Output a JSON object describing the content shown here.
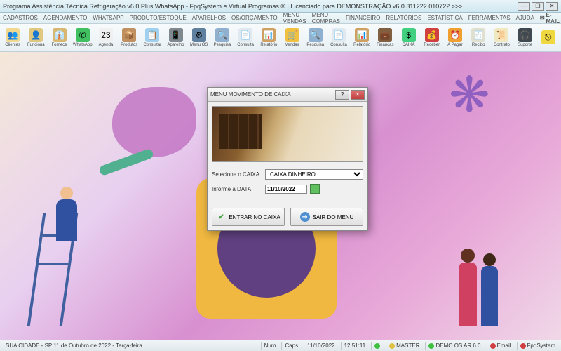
{
  "window": {
    "title": "Programa Assistência Técnica Refrigeração v6.0 Plus WhatsApp - FpqSystem e Virtual Programas ® | Licenciado para DEMONSTRAÇÃO v6.0 311222 010722 >>>"
  },
  "menubar": {
    "items": [
      "CADASTROS",
      "AGENDAMENTO",
      "WHATSAPP",
      "PRODUTO/ESTOQUE",
      "APARELHOS",
      "OS/ORÇAMENTO",
      "MENU VENDAS",
      "MENU COMPRAS",
      "FINANCEIRO",
      "RELATÓRIOS",
      "ESTATÍSTICA",
      "FERRAMENTAS",
      "AJUDA"
    ],
    "email": "E-MAIL"
  },
  "toolbar": {
    "buttons": [
      {
        "label": "Clientes",
        "icon": "👥",
        "bg": "#f0d890"
      },
      {
        "label": "Funciona",
        "icon": "👤",
        "bg": "#e0c880"
      },
      {
        "label": "Fornece",
        "icon": "👔",
        "bg": "#d8b870"
      },
      {
        "label": "WhatsApp",
        "icon": "✆",
        "bg": "#40c060"
      },
      {
        "label": "Agenda",
        "icon": "23",
        "bg": "#f0f0f0"
      },
      {
        "label": "Produtos",
        "icon": "📦",
        "bg": "#c09060"
      },
      {
        "label": "Consultar",
        "icon": "📋",
        "bg": "#a0d0f0"
      },
      {
        "label": "Aparelho",
        "icon": "📱",
        "bg": "#808890"
      },
      {
        "label": "Menu OS",
        "icon": "⚙",
        "bg": "#6080a0"
      },
      {
        "label": "Pesquisa",
        "icon": "🔍",
        "bg": "#90b0d0"
      },
      {
        "label": "Consulta",
        "icon": "📄",
        "bg": "#e0e8f0"
      },
      {
        "label": "Relatório",
        "icon": "📊",
        "bg": "#d0a060"
      },
      {
        "label": "Vendas",
        "icon": "🛒",
        "bg": "#f0c040"
      },
      {
        "label": "Pesquisa",
        "icon": "🔍",
        "bg": "#90b0d0"
      },
      {
        "label": "Consulta",
        "icon": "📄",
        "bg": "#e0e8f0"
      },
      {
        "label": "Relatório",
        "icon": "📊",
        "bg": "#d0a060"
      },
      {
        "label": "Finanças",
        "icon": "💼",
        "bg": "#806040"
      },
      {
        "label": "CAIXA",
        "icon": "$",
        "bg": "#40d080"
      },
      {
        "label": "Receber",
        "icon": "💰",
        "bg": "#d04040"
      },
      {
        "label": "A Pagar",
        "icon": "⏰",
        "bg": "#f0a030"
      },
      {
        "label": "Recibo",
        "icon": "🧾",
        "bg": "#e0e0d0"
      },
      {
        "label": "Contrato",
        "icon": "📜",
        "bg": "#f0e8c0"
      },
      {
        "label": "Suporte",
        "icon": "🎧",
        "bg": "#404850"
      },
      {
        "label": "",
        "icon": "⎋",
        "bg": "#f0d840"
      }
    ]
  },
  "dialog": {
    "title": "MENU MOVIMENTO DE CAIXA",
    "select_label": "Selecione o CAIXA",
    "select_value": "CAIXA DINHEIRO",
    "date_label": "Informe a DATA",
    "date_value": "11/10/2022",
    "btn_enter": "ENTRAR NO CAIXA",
    "btn_exit": "SAIR DO MENU"
  },
  "statusbar": {
    "location": "SUA CIDADE - SP 11 de Outubro de 2022 - Terça-feira",
    "num": "Num",
    "caps": "Caps",
    "date": "11/10/2022",
    "time": "12:51:11",
    "user": "MASTER",
    "version": "DEMO OS AR 6.0",
    "email": "Email",
    "brand": "FpqSystem"
  }
}
